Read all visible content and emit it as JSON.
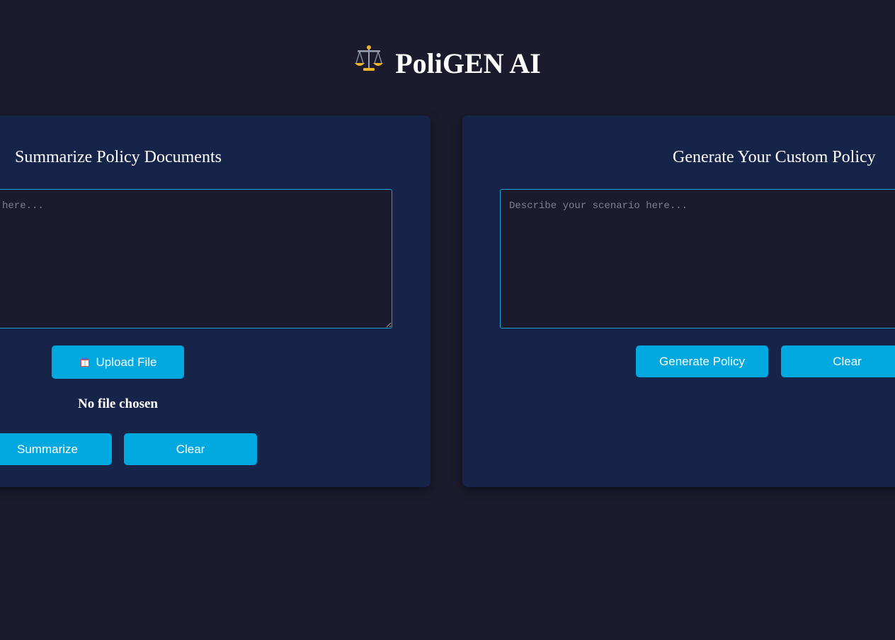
{
  "header": {
    "title": "PoliGEN AI",
    "logo_icon": "scales-icon"
  },
  "summarize_panel": {
    "heading": "Summarize Policy Documents",
    "textarea_placeholder": "text here...",
    "upload_button_label": "Upload File",
    "upload_icon": "book-icon",
    "file_status": "No file chosen",
    "summarize_button_label": "Summarize",
    "clear_button_label": "Clear"
  },
  "generate_panel": {
    "heading": "Generate Your Custom Policy",
    "textarea_placeholder": "Describe your scenario here...",
    "generate_button_label": "Generate Policy",
    "clear_button_label": "Clear"
  },
  "colors": {
    "page_background": "#1b1b2d",
    "card_background": "#16244a",
    "accent": "#00a8e0",
    "textarea_border": "#1aa3d9",
    "icon_gold": "#f0b429"
  }
}
